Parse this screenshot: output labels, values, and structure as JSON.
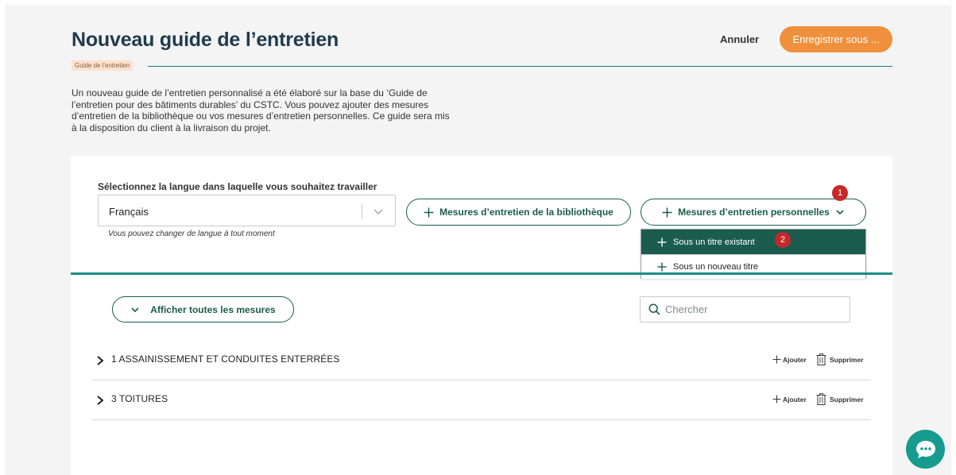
{
  "header": {
    "title": "Nouveau guide de l’entretien",
    "cancel_label": "Annuler",
    "save_label": "Enregistrer sous ..."
  },
  "breadcrumb": {
    "label": "Guide de l'entretien"
  },
  "intro": {
    "line1": "Un nouveau guide de l’entretien personnalisé a été élaboré sur la base du ‘Guide de",
    "line2": "l’entretien pour des bâtiments durables’ du CSTC. Vous pouvez ajouter des mesures",
    "line3": "d’entretien de la bibliothèque ou vos mesures d’entretien personnelles. Ce guide sera mis",
    "line4": "à la disposition du client à la livraison du projet."
  },
  "language": {
    "label": "Sélectionnez la langue dans laquelle vous souhaitez travailler",
    "value": "Français",
    "hint": "Vous pouvez changer de langue à tout moment"
  },
  "actions": {
    "library_label": "Mesures d’entretien de la bibliothèque",
    "personal_label": "Mesures d’entretien personnelles"
  },
  "badges": {
    "one": "1",
    "two": "2"
  },
  "dropdown": {
    "items": [
      {
        "label": "Sous un titre existant"
      },
      {
        "label": "Sous un nouveau titre"
      }
    ]
  },
  "list": {
    "show_all_label": "Afficher toutes les mesures",
    "search_placeholder": "Chercher",
    "rows": [
      {
        "title": "1 ASSAINISSEMENT ET CONDUITES ENTERRÉES",
        "add_label": "Ajouter",
        "delete_label": "Supprimer"
      },
      {
        "title": "3 TOITURES",
        "add_label": "Ajouter",
        "delete_label": "Supprimer"
      }
    ]
  },
  "colors": {
    "brand_green": "#1a5c4d",
    "accent_orange": "#f0903d",
    "teal_line": "#1a8d86",
    "badge_red": "#c62828",
    "chat_teal": "#179b8e"
  },
  "icons": [
    "chevron-down-icon",
    "plus-icon",
    "search-icon",
    "chevron-right-icon",
    "trash-icon",
    "chat-icon"
  ]
}
